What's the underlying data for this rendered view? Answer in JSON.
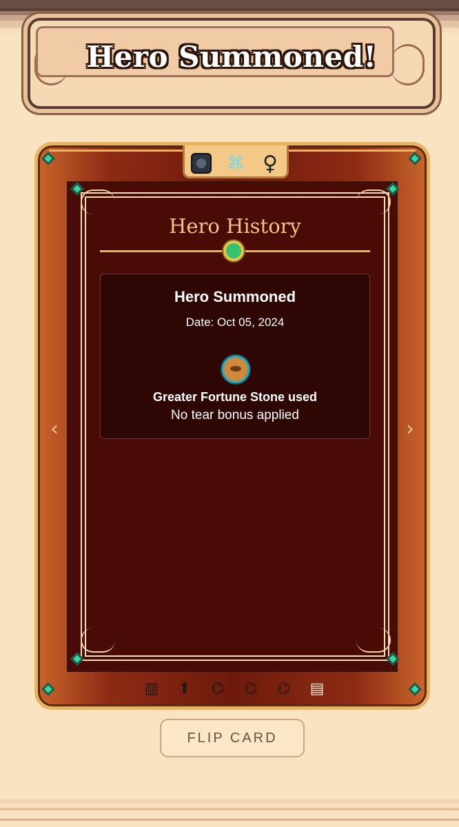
{
  "header": {
    "title": "Hero Summoned!"
  },
  "card": {
    "top_icons": [
      {
        "name": "hero-class-icon",
        "glyph": ""
      },
      {
        "name": "dna-icon",
        "glyph": "⌘"
      },
      {
        "name": "female-icon",
        "glyph": "♀"
      }
    ],
    "section_title": "Hero History",
    "entry": {
      "title": "Hero Summoned",
      "date": "Date: Oct 05, 2024",
      "item_icon": "fortune-stone-icon",
      "item_text": "Greater Fortune Stone used",
      "bonus_text": "No tear bonus applied"
    },
    "nav": {
      "prev": "‹",
      "next": "›"
    },
    "bottom_icons": [
      {
        "name": "stats-icon",
        "glyph": "▥"
      },
      {
        "name": "level-up-icon",
        "glyph": "⬆"
      },
      {
        "name": "genes-icon",
        "glyph": "⌬"
      },
      {
        "name": "genes-r1-icon",
        "glyph": "⌬"
      },
      {
        "name": "genes-r2-icon",
        "glyph": "⌬"
      },
      {
        "name": "scroll-icon",
        "glyph": "▤"
      }
    ]
  },
  "flip_button": {
    "label": "FLIP CARD"
  },
  "colors": {
    "background": "#fae3c1",
    "card_gold": "#e8b462",
    "card_red": "#4a0a06",
    "title_gold": "#f1c48a"
  }
}
